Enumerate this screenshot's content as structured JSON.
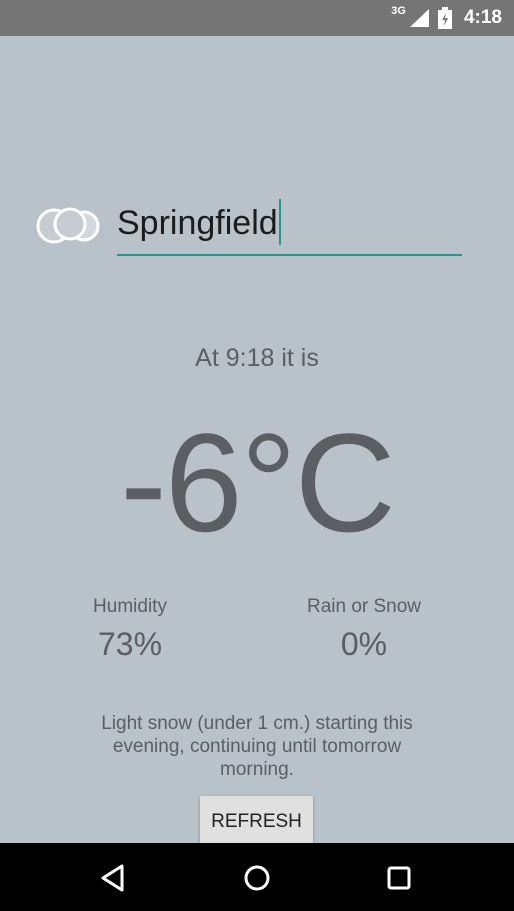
{
  "status_bar": {
    "network_label": "3G",
    "time": "4:18",
    "icons": [
      "signal-icon",
      "battery-icon"
    ]
  },
  "app": {
    "city_input_value": "Springfield",
    "time_line": "At 9:18 it is",
    "temperature": "-6°C",
    "humidity_label": "Humidity",
    "humidity_value": "73%",
    "precip_label": "Rain or Snow",
    "precip_value": "0%",
    "description": "Light snow (under 1 cm.) starting this evening, continuing until tomorrow morning.",
    "refresh_label": "REFRESH"
  },
  "nav_bar": {
    "icons": [
      "back-icon",
      "home-icon",
      "recents-icon"
    ]
  },
  "colors": {
    "background": "#b9c1c9",
    "accent": "#28968d",
    "text": "#5b5e62"
  }
}
